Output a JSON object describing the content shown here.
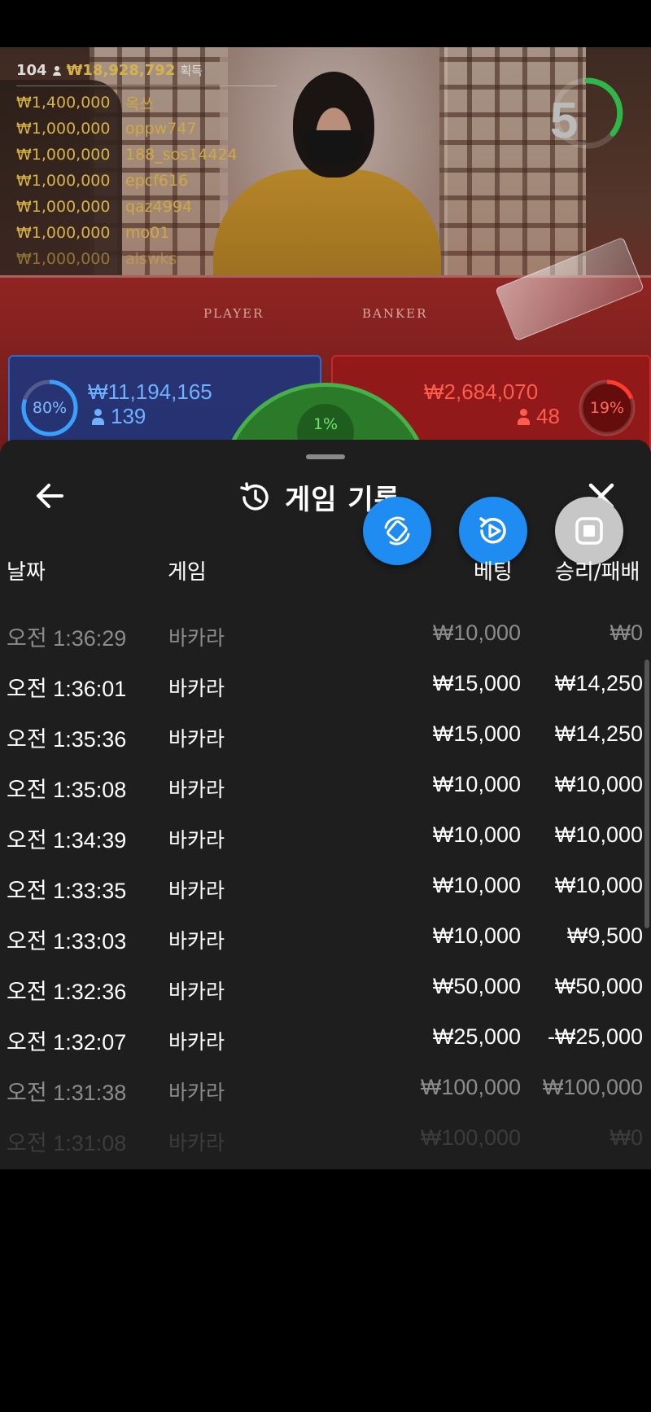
{
  "live": {
    "winners": {
      "count": "104",
      "total": "₩18,928,792",
      "suffix": "획득",
      "rows": [
        {
          "amount": "₩1,400,000",
          "user": "옥쓰"
        },
        {
          "amount": "₩1,000,000",
          "user": "oppw747"
        },
        {
          "amount": "₩1,000,000",
          "user": "188_sos14424"
        },
        {
          "amount": "₩1,000,000",
          "user": "epcf616"
        },
        {
          "amount": "₩1,000,000",
          "user": "qaz4994"
        },
        {
          "amount": "₩1,000,000",
          "user": "mo01"
        },
        {
          "amount": "₩1,000,000",
          "user": "alswks"
        }
      ]
    },
    "timer": "5",
    "felt": {
      "player": "PLAYER",
      "banker": "BANKER"
    },
    "player": {
      "percent": "80%",
      "amount": "₩11,194,165",
      "bettors": "139"
    },
    "banker": {
      "percent": "19%",
      "amount": "₩2,684,070",
      "bettors": "48"
    },
    "tie": {
      "percent": "1%"
    }
  },
  "sheet": {
    "title": "게임 기록",
    "columns": {
      "date": "날짜",
      "game": "게임",
      "bet": "베팅",
      "result": "승리/패배"
    },
    "rows": [
      {
        "time": "오전 1:36:29",
        "game": "바카라",
        "bet": "₩10,000",
        "result": "₩0",
        "state": "dim"
      },
      {
        "time": "오전 1:36:01",
        "game": "바카라",
        "bet": "₩15,000",
        "result": "₩14,250",
        "state": "normal"
      },
      {
        "time": "오전 1:35:36",
        "game": "바카라",
        "bet": "₩15,000",
        "result": "₩14,250",
        "state": "normal"
      },
      {
        "time": "오전 1:35:08",
        "game": "바카라",
        "bet": "₩10,000",
        "result": "₩10,000",
        "state": "normal"
      },
      {
        "time": "오전 1:34:39",
        "game": "바카라",
        "bet": "₩10,000",
        "result": "₩10,000",
        "state": "normal"
      },
      {
        "time": "오전 1:33:35",
        "game": "바카라",
        "bet": "₩10,000",
        "result": "₩10,000",
        "state": "normal"
      },
      {
        "time": "오전 1:33:03",
        "game": "바카라",
        "bet": "₩10,000",
        "result": "₩9,500",
        "state": "normal"
      },
      {
        "time": "오전 1:32:36",
        "game": "바카라",
        "bet": "₩50,000",
        "result": "₩50,000",
        "state": "normal"
      },
      {
        "time": "오전 1:32:07",
        "game": "바카라",
        "bet": "₩25,000",
        "result": "-₩25,000",
        "state": "normal"
      },
      {
        "time": "오전 1:31:38",
        "game": "바카라",
        "bet": "₩100,000",
        "result": "₩100,000",
        "state": "dim"
      },
      {
        "time": "오전 1:31:08",
        "game": "바카라",
        "bet": "₩100,000",
        "result": "₩0",
        "state": "dimmer"
      }
    ]
  },
  "colors": {
    "accent_blue": "#1e8cf0",
    "gold": "#d8b24a",
    "sheet_bg": "#1e1e1e",
    "player_blue": "#2f68c8",
    "banker_red": "#c02a2a",
    "tie_green": "#48b048"
  },
  "icons": [
    "back-arrow-icon",
    "history-icon",
    "close-icon",
    "rotate-screen-icon",
    "replay-icon",
    "stop-icon",
    "person-icon"
  ]
}
